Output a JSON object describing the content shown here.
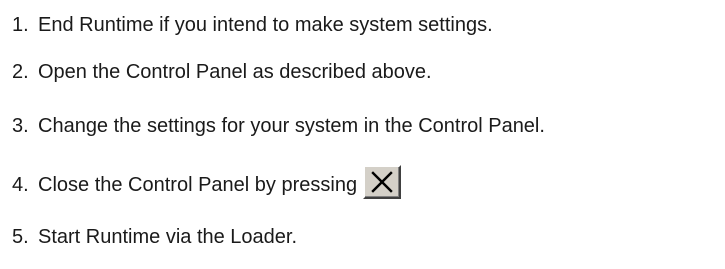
{
  "steps": [
    {
      "number": "1.",
      "text": "End Runtime if you intend to make system settings."
    },
    {
      "number": "2.",
      "text": "Open the Control Panel as described above."
    },
    {
      "number": "3.",
      "text": "Change the settings for your system in the Control Panel."
    },
    {
      "number": "4.",
      "text": "Close the Control Panel by pressing"
    },
    {
      "number": "5.",
      "text": "Start Runtime via the Loader."
    }
  ],
  "close_button": {
    "icon": "close-icon",
    "face_color": "#d4d0c8"
  }
}
